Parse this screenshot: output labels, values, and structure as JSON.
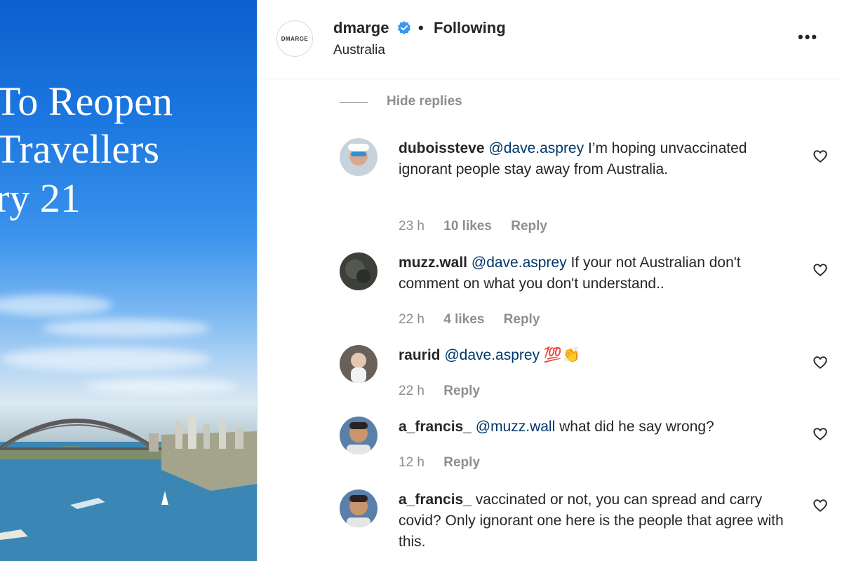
{
  "media": {
    "headline_lines": [
      "To Reopen",
      "Travellers",
      "ry 21"
    ]
  },
  "header": {
    "brand_avatar_text": "DMARGE",
    "username": "dmarge",
    "separator": "•",
    "follow_status": "Following",
    "location": "Australia",
    "more_label": "•••"
  },
  "thread": {
    "hide_replies_label": "Hide replies"
  },
  "comments": [
    {
      "username": "duboissteve",
      "mention": "@dave.asprey",
      "text": " I’m hoping unvaccinated ignorant people stay away from Australia.",
      "time": "23 h",
      "likes": "10 likes",
      "reply": "Reply",
      "avatar_color": "#9db6c9"
    },
    {
      "username": "muzz.wall",
      "mention": "@dave.asprey",
      "text": " If your not Australian don't comment on what you don't understand..",
      "time": "22 h",
      "likes": "4 likes",
      "reply": "Reply",
      "avatar_color": "#3d3f3a"
    },
    {
      "username": "raurid",
      "mention": "@dave.asprey",
      "text": " 💯👏",
      "time": "22 h",
      "likes": "",
      "reply": "Reply",
      "avatar_color": "#6a6058"
    },
    {
      "username": "a_francis_",
      "mention": "@muzz.wall",
      "text": " what did he say wrong?",
      "time": "12 h",
      "likes": "",
      "reply": "Reply",
      "avatar_color": "#5a7fa8"
    },
    {
      "username": "a_francis_",
      "mention": "",
      "text": " vaccinated or not, you can spread and carry covid? Only ignorant one here is the people that agree with this.",
      "time": "",
      "likes": "",
      "reply": "",
      "avatar_color": "#5a7fa8"
    }
  ],
  "colors": {
    "verified_badge": "#3897f0",
    "mention": "#00376b",
    "meta_text": "#8e8e8e"
  }
}
